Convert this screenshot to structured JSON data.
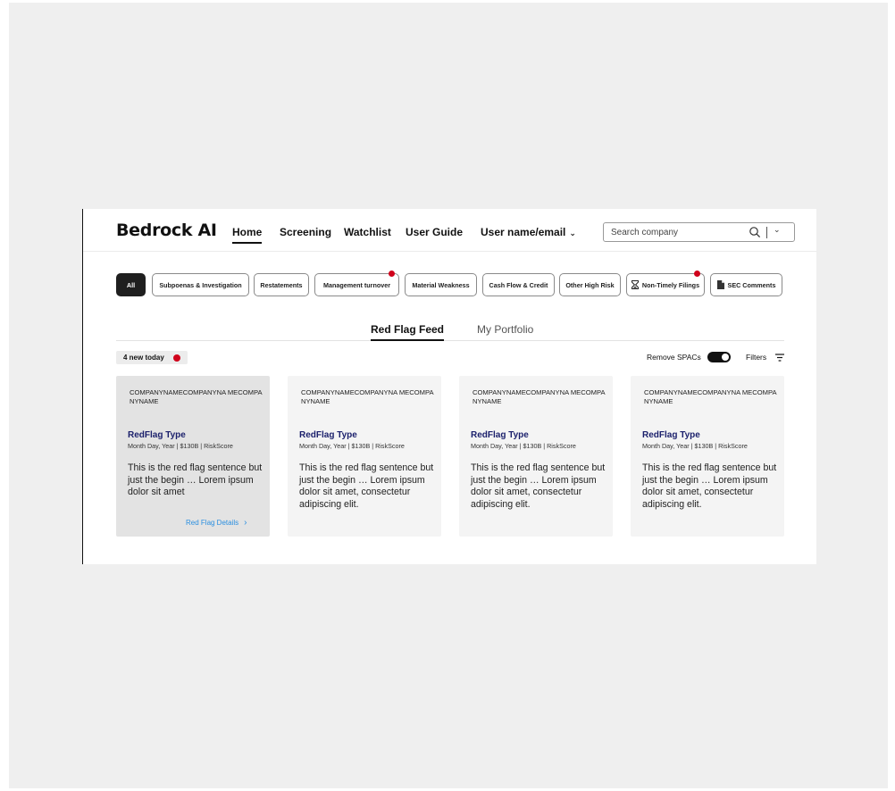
{
  "app": {
    "logo": "Bedrock AI"
  },
  "nav": {
    "home": "Home",
    "screening": "Screening",
    "watchlist": "Watchlist",
    "user_guide": "User Guide",
    "user_menu": "User name/email"
  },
  "search": {
    "placeholder": "Search company"
  },
  "chips": {
    "all": "All",
    "subpoenas": "Subpoenas & Investigation",
    "restatements": "Restatements",
    "management": "Management turnover",
    "material": "Material Weakness",
    "cashflow": "Cash Flow & Credit",
    "other": "Other High Risk",
    "nontimely": "Non-Timely Filings",
    "sec": "SEC Comments"
  },
  "chip_alerts": [
    "Management turnover",
    "Non-Timely Filings"
  ],
  "colors": {
    "alert_dot": "#d0021b",
    "flag_type": "#1a1f6b",
    "details_link": "#2b8fe0",
    "active_chip": "#1f1f1f"
  },
  "feed_tabs": {
    "red_flag_feed": "Red Flag Feed",
    "my_portfolio": "My Portfolio"
  },
  "summary": {
    "new_today": "4 new today",
    "remove_spacs": "Remove SPACs",
    "remove_spacs_on": true,
    "filters": "Filters"
  },
  "cards": [
    {
      "company": "COMPANYNAMECOMPANYNA MECOMPANYNAME",
      "flag_type": "RedFlag Type",
      "meta": "Month Day, Year | $130B | RiskScore",
      "sentence": "This is the red flag sentence but just the begin … Lorem ipsum dolor sit amet",
      "details": "Red Flag Details"
    },
    {
      "company": "COMPANYNAMECOMPANYNA MECOMPANYNAME",
      "flag_type": "RedFlag Type",
      "meta": "Month Day, Year | $130B | RiskScore",
      "sentence": "This is the red flag sentence but just the begin … Lorem ipsum dolor sit amet, consectetur adipiscing elit."
    },
    {
      "company": "COMPANYNAMECOMPANYNA MECOMPANYNAME",
      "flag_type": "RedFlag Type",
      "meta": "Month Day, Year | $130B | RiskScore",
      "sentence": "This is the red flag sentence but just the begin … Lorem ipsum dolor sit amet, consectetur adipiscing elit."
    },
    {
      "company": "COMPANYNAMECOMPANYNA MECOMPANYNAME",
      "flag_type": "RedFlag Type",
      "meta": "Month Day, Year | $130B | RiskScore",
      "sentence": "This is the red flag sentence but just the begin … Lorem ipsum dolor sit amet, consectetur adipiscing elit."
    }
  ]
}
